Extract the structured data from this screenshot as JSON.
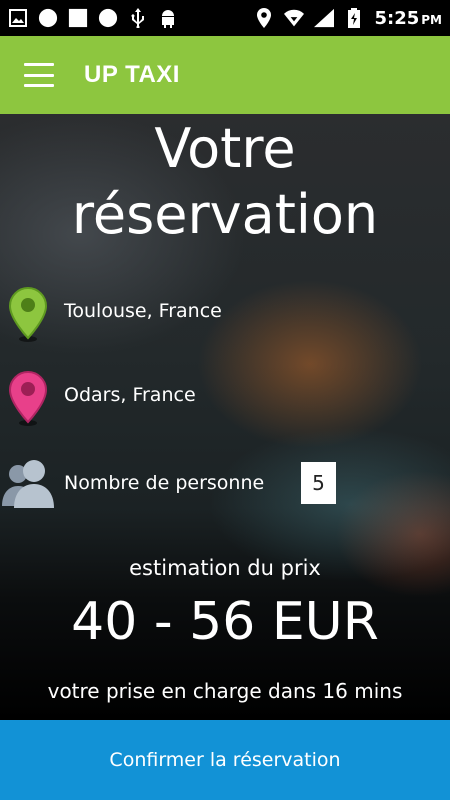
{
  "status_bar": {
    "time": "5:25",
    "ampm": "PM",
    "icons": [
      "image-icon",
      "circle-icon",
      "square-icon",
      "circle-icon",
      "usb-icon",
      "android-icon",
      "location-icon",
      "wifi-icon",
      "signal-icon",
      "battery-icon"
    ]
  },
  "app_bar": {
    "title": "UP TAXI",
    "menu_icon": "hamburger-menu-icon",
    "color": "#8dc63f"
  },
  "reservation": {
    "title_line1": "Votre",
    "title_line2": "réservation",
    "pickup_location": "Toulouse, France",
    "pickup_pin_color": "#8dc63f",
    "dropoff_location": "Odars, France",
    "dropoff_pin_color": "#e8408a",
    "people_label": "Nombre de personne",
    "people_count": "5"
  },
  "estimate": {
    "label": "estimation du prix",
    "price": "40 - 56 EUR",
    "pickup_text": "votre prise en charge dans 16 mins"
  },
  "confirm": {
    "label": "Confirmer la réservation",
    "color": "#1292d6"
  }
}
